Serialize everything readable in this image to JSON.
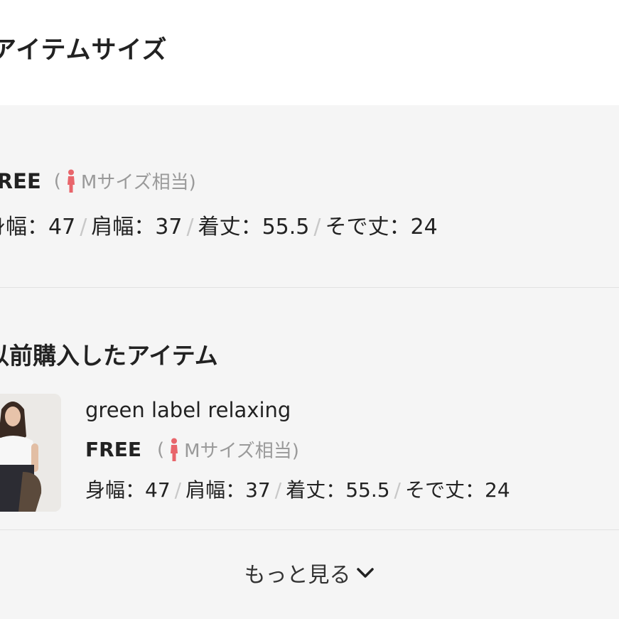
{
  "page": {
    "title": "アイテムサイズ"
  },
  "current_size": {
    "size_label": "FREE",
    "equiv_open": "(",
    "equiv_text": "Mサイズ相当)",
    "measurements": [
      {
        "label": "身幅：",
        "value": "47"
      },
      {
        "label": "肩幅：",
        "value": "37"
      },
      {
        "label": "着丈：",
        "value": "55.5"
      },
      {
        "label": "そで丈：",
        "value": "24"
      }
    ],
    "separator": "/"
  },
  "past_purchase": {
    "section_title": "以前購入したアイテム",
    "brand": "green label relaxing",
    "size_label": "FREE",
    "equiv_open": "(",
    "equiv_text": "Mサイズ相当)",
    "measurements": [
      {
        "label": "身幅：",
        "value": "47"
      },
      {
        "label": "肩幅：",
        "value": "37"
      },
      {
        "label": "着丈：",
        "value": "55.5"
      },
      {
        "label": "そで丈：",
        "value": "24"
      }
    ],
    "separator": "/"
  },
  "more_button": {
    "label": "もっと見る",
    "icon": "chevron-down-icon"
  },
  "colors": {
    "panel_bg": "#f5f5f5",
    "person_icon": "#e8656b",
    "muted_text": "#9a9a9a",
    "separator": "#c8c8c8"
  }
}
